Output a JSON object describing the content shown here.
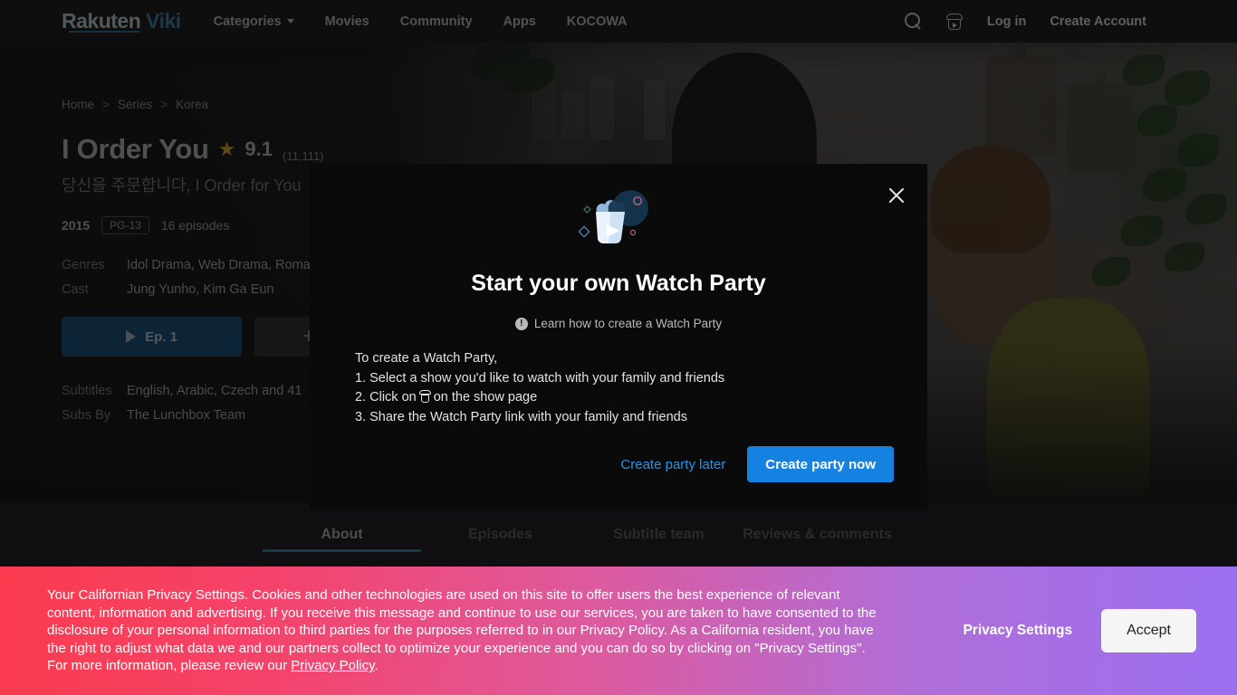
{
  "header": {
    "logo": {
      "rakuten": "Rakuten",
      "viki": "Viki"
    },
    "nav": [
      {
        "label": "Categories",
        "has_caret": true
      },
      {
        "label": "Movies",
        "has_caret": false
      },
      {
        "label": "Community",
        "has_caret": false
      },
      {
        "label": "Apps",
        "has_caret": false
      },
      {
        "label": "KOCOWA",
        "has_caret": false
      }
    ],
    "icons": [
      "search-icon",
      "watch-party-bucket-icon"
    ],
    "login_label": "Log in",
    "create_account_label": "Create Account"
  },
  "hero": {
    "breadcrumb": [
      "Home",
      "Series",
      "Korea"
    ],
    "breadcrumb_separator": ">",
    "title": "I Order You",
    "star_glyph": "★",
    "rating": "9.1",
    "rating_count": "(11,111)",
    "native_title": "당신을 주문합니다, I Order for You",
    "year": "2015",
    "content_rating": "PG-13",
    "episodes": "16 episodes",
    "genres_label": "Genres",
    "genres_value": "Idol Drama, Web Drama, Romance",
    "cast_label": "Cast",
    "cast_value": "Jung Yunho, Kim Ga Eun",
    "play_button": "Ep. 1",
    "add_button": "+",
    "subtitles_label": "Subtitles",
    "subtitles_value": "English, Arabic, Czech and 41",
    "subs_by_label": "Subs By",
    "subs_by_value": "The Lunchbox Team"
  },
  "tabs": [
    {
      "label": "About",
      "active": true
    },
    {
      "label": "Episodes",
      "active": false
    },
    {
      "label": "Subtitle team",
      "active": false
    },
    {
      "label": "Reviews & comments",
      "active": false
    }
  ],
  "modal": {
    "title": "Start your own Watch Party",
    "learn_link": "Learn how to create a Watch Party",
    "info_glyph": "!",
    "intro": "To create a Watch Party,",
    "step1": "1. Select a show you'd like to watch with your family and friends",
    "step2_pre": "2. Click on",
    "step2_post": "on the show page",
    "step3": "3. Share the Watch Party link with your family and friends",
    "later_button": "Create party later",
    "now_button": "Create party now",
    "close_icon": "close-icon"
  },
  "privacy": {
    "body": "Your Californian Privacy Settings. Cookies and other technologies are used on this site to offer users the best experience of relevant content, information and advertising. If you receive this message and continue to use our services, you are taken to have consented to the disclosure of your personal information to third parties for the purposes referred to in our Privacy Policy. As a California resident, you have the right to adjust what data we and our partners collect to optimize your experience and you can do so by clicking on \"Privacy Settings\". For more information, please review our ",
    "link": "Privacy Policy",
    "period": ".",
    "settings_button": "Privacy Settings",
    "accept_button": "Accept"
  },
  "colors": {
    "accent_blue": "#1581e0",
    "link_blue": "#2196f3",
    "play_button": "#1d4f78",
    "star_gold": "#c9a227",
    "banner_start": "#fb3b4e",
    "banner_end": "#9b6ff1",
    "modal_bg": "#0a0a0a"
  }
}
